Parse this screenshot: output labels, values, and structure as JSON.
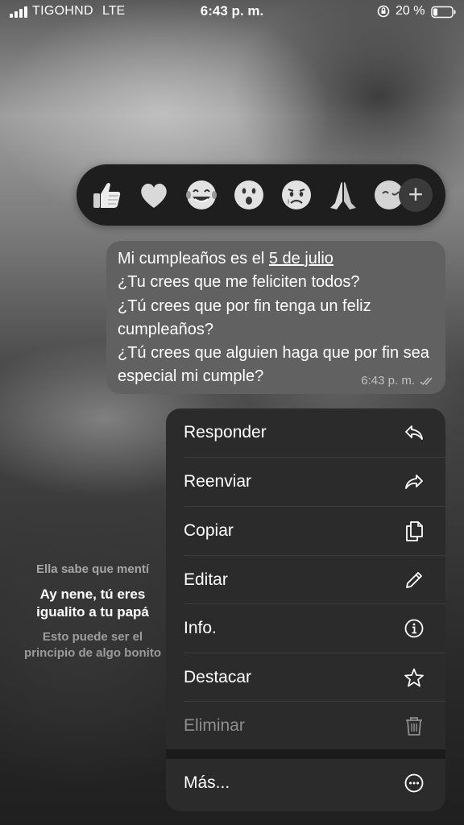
{
  "status_bar": {
    "carrier": "TIGOHND",
    "network": "LTE",
    "time": "6:43 p. m.",
    "battery_percent": "20 %",
    "icons": [
      "signal-bars-icon",
      "orientation-lock-icon",
      "battery-icon"
    ]
  },
  "background_stories": {
    "line1": "Ella sabe que mentí",
    "line2": "Ay nene, tú eres igualito a tu papá",
    "line3": "Esto puede ser el principio de algo bonito"
  },
  "reactions": {
    "items": [
      {
        "name": "thumbs-up",
        "icon": "thumbs-up-icon"
      },
      {
        "name": "heart",
        "icon": "heart-icon"
      },
      {
        "name": "tears-of-joy",
        "icon": "tears-of-joy-icon"
      },
      {
        "name": "surprised",
        "icon": "surprised-face-icon"
      },
      {
        "name": "crying",
        "icon": "crying-face-icon"
      },
      {
        "name": "praying-hands",
        "icon": "praying-hands-icon"
      },
      {
        "name": "more-emoji",
        "icon": "emoji-face-icon"
      }
    ],
    "add_label": "+"
  },
  "message": {
    "text_before_date": "Mi cumpleaños es el ",
    "date_link": "5 de julio",
    "text_after_date": "\n¿Tu crees que me feliciten todos?\n¿Tú crees que por fin tenga un feliz cumpleaños?\n¿Tú crees que alguien haga que por fin sea especial mi cumple?",
    "time": "6:43 p. m.",
    "status_icon": "double-check-icon"
  },
  "context_menu": {
    "items": [
      {
        "label": "Responder",
        "icon": "reply-icon"
      },
      {
        "label": "Reenviar",
        "icon": "forward-icon"
      },
      {
        "label": "Copiar",
        "icon": "copy-icon"
      },
      {
        "label": "Editar",
        "icon": "pencil-icon"
      },
      {
        "label": "Info.",
        "icon": "info-icon"
      },
      {
        "label": "Destacar",
        "icon": "star-icon"
      },
      {
        "label": "Eliminar",
        "icon": "trash-icon"
      },
      {
        "label": "Más...",
        "icon": "more-icon"
      }
    ]
  },
  "colors": {
    "menu_background": "#2b2b2b",
    "bubble_background": "#616161",
    "reaction_bar_background": "#1e1e1e",
    "destructive_disabled_text": "#8e8e8e"
  }
}
